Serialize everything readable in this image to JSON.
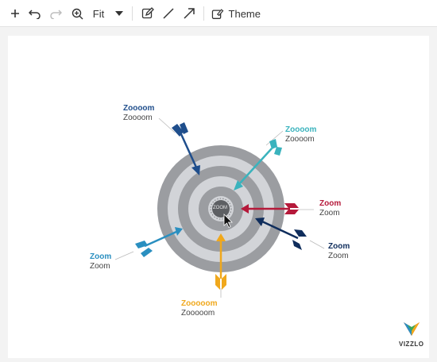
{
  "toolbar": {
    "zoom_value": "Fit",
    "theme_label": "Theme"
  },
  "target": {
    "center_label": "ZOOM"
  },
  "labels": {
    "top_left": {
      "title": "Zoooom",
      "subtitle": "Zoooom",
      "color": "#1f4e8c"
    },
    "top_right": {
      "title": "Zoooom",
      "subtitle": "Zoooom",
      "color": "#3ab3bd"
    },
    "right": {
      "title": "Zoom",
      "subtitle": "Zoom",
      "color": "#b5193a"
    },
    "bottom_right": {
      "title": "Zoom",
      "subtitle": "Zoom",
      "color": "#0f2d5c"
    },
    "left": {
      "title": "Zoom",
      "subtitle": "Zoom",
      "color": "#2a8fc0"
    },
    "bottom": {
      "title": "Zooooom",
      "subtitle": "Zooooom",
      "color": "#f0a81c"
    }
  },
  "logo": {
    "text": "VIZZLO"
  },
  "icons": {
    "add": "plus-icon",
    "undo": "undo-icon",
    "redo": "redo-icon",
    "zoom": "zoom-in-icon",
    "dropdown": "caret-down-icon",
    "edit": "edit-icon",
    "line": "line-icon",
    "arrow": "arrow-icon",
    "theme": "theme-icon"
  }
}
